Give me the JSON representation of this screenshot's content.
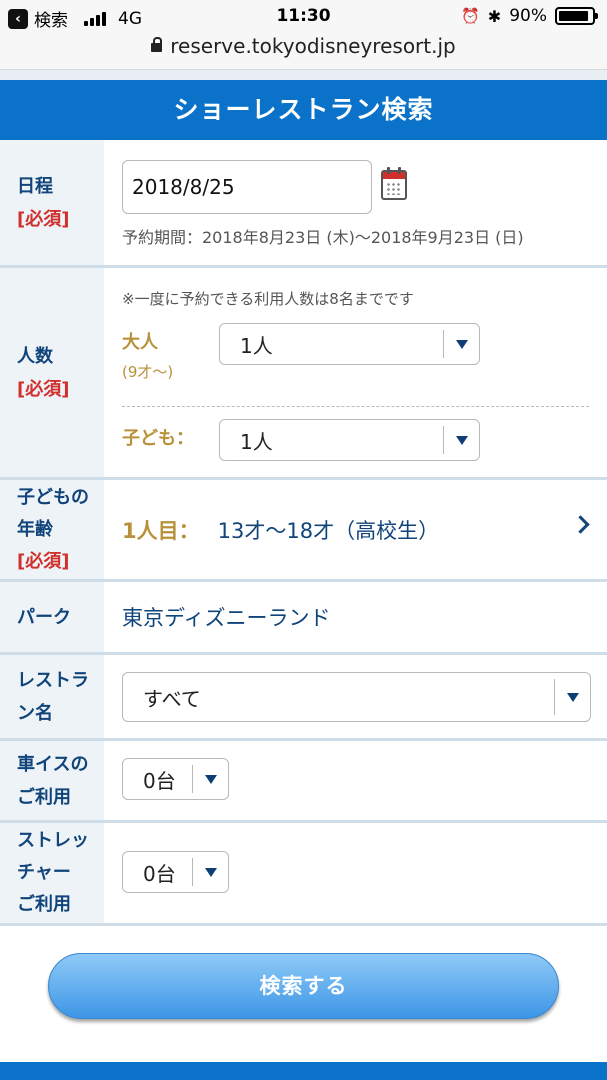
{
  "status_bar": {
    "back_label": "検索",
    "network": "4G",
    "time": "11:30",
    "battery": "90%",
    "battery_level": 0.9
  },
  "url_bar": {
    "url": "reserve.tokyodisneyresort.jp"
  },
  "header": {
    "title": "ショーレストラン検索"
  },
  "form": {
    "date": {
      "label": "日程",
      "required": "[必須]",
      "value": "2018/8/25",
      "period": "予約期間：2018年8月23日 (木)〜2018年9月23日 (日)"
    },
    "people": {
      "label": "人数",
      "required": "[必須]",
      "note": "※一度に予約できる利用人数は8名までです",
      "adult_label": "大人",
      "adult_hint": "(9才〜)",
      "adult_value": "1人",
      "child_label": "子ども：",
      "child_value": "1人"
    },
    "child_age": {
      "label_line1": "子どもの",
      "label_line2": "年齢",
      "required": "[必須]",
      "ordinal": "1人目：",
      "value": "13才〜18才（高校生）"
    },
    "park": {
      "label": "パーク",
      "value": "東京ディズニーランド"
    },
    "restaurant": {
      "label_line1": "レストラ",
      "label_line2": "ン名",
      "value": "すべて"
    },
    "wheelchair": {
      "label_line1": "車イスの",
      "label_line2": "ご利用",
      "value": "0台"
    },
    "stretcher": {
      "label_line1": "ストレッ",
      "label_line2": "チャー",
      "label_line3": "ご利用",
      "value": "0台"
    }
  },
  "search_button": {
    "label": "検索する"
  },
  "colors": {
    "brand_blue": "#0a72c8",
    "label_navy": "#10447a",
    "required_red": "#d0312d",
    "gold": "#b8923a"
  },
  "icons": [
    "back-icon",
    "signal-icon",
    "alarm-icon",
    "bluetooth-icon",
    "battery-icon",
    "lock-icon",
    "calendar-icon",
    "dropdown-arrow-icon",
    "chevron-right-icon"
  ]
}
